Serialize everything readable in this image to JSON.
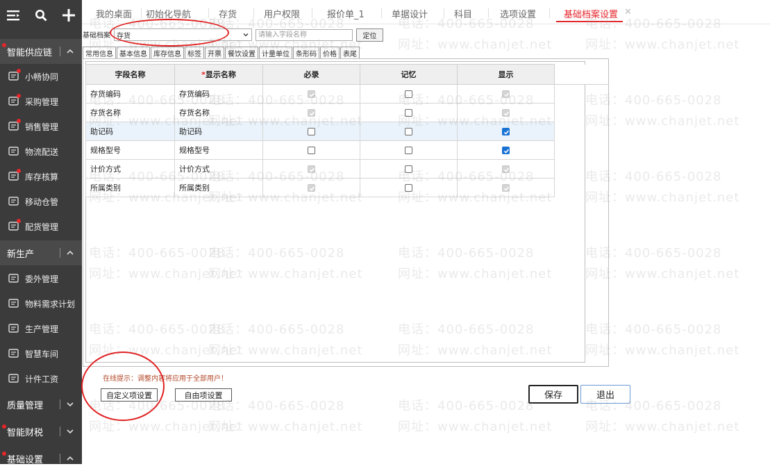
{
  "sidebar": {
    "sections": [
      {
        "label": "智能供应链"
      },
      {
        "label": "新生产"
      },
      {
        "label": "质量管理"
      },
      {
        "label": "智能财税"
      },
      {
        "label": "基础设置"
      }
    ],
    "items_a": [
      {
        "label": "小畅协同",
        "icon": "people-icon"
      },
      {
        "label": "采购管理",
        "icon": "cart-icon"
      },
      {
        "label": "销售管理",
        "icon": "bar-chart-icon"
      },
      {
        "label": "物流配送",
        "icon": "truck-icon"
      },
      {
        "label": "库存核算",
        "icon": "warehouse-icon"
      },
      {
        "label": "移动仓管",
        "icon": "mobile-warehouse-icon"
      },
      {
        "label": "配货管理",
        "icon": "distribution-icon"
      }
    ],
    "items_b": [
      {
        "label": "委外管理",
        "icon": "outsource-icon"
      },
      {
        "label": "物料需求计划",
        "icon": "material-plan-icon"
      },
      {
        "label": "生产管理",
        "icon": "production-icon"
      },
      {
        "label": "智慧车间",
        "icon": "workshop-icon"
      },
      {
        "label": "计件工资",
        "icon": "wage-icon"
      }
    ]
  },
  "tabs": [
    {
      "label": "我的桌面"
    },
    {
      "label": "初始化导航"
    },
    {
      "label": "存货"
    },
    {
      "label": "用户权限"
    },
    {
      "label": "报价单_1"
    },
    {
      "label": "单据设计"
    },
    {
      "label": "科目"
    },
    {
      "label": "选项设置"
    },
    {
      "label": "基础档案设置"
    }
  ],
  "toolbar": {
    "label": "基础档案",
    "select_value": "存货",
    "search_placeholder": "请输入字段名称",
    "locate_label": "定位"
  },
  "subtabs": [
    "常用信息",
    "基本信息",
    "库存信息",
    "标签",
    "开票",
    "餐饮设置",
    "计量单位",
    "条形码",
    "价格",
    "表尾"
  ],
  "grid": {
    "headers": {
      "field": "字段名称",
      "required_mark": "*",
      "display": "显示名称",
      "required": "必录",
      "memory": "记忆",
      "show": "显示"
    },
    "rows": [
      {
        "field": "存货编码",
        "display": "存货编码",
        "required": {
          "checked": true,
          "disabled": true
        },
        "memory": {
          "checked": false,
          "disabled": false
        },
        "show": {
          "checked": true,
          "disabled": true
        }
      },
      {
        "field": "存货名称",
        "display": "存货名称",
        "required": {
          "checked": true,
          "disabled": true
        },
        "memory": {
          "checked": false,
          "disabled": false
        },
        "show": {
          "checked": true,
          "disabled": true
        }
      },
      {
        "field": "助记码",
        "display": "助记码",
        "required": {
          "checked": false,
          "disabled": false
        },
        "memory": {
          "checked": false,
          "disabled": false
        },
        "show": {
          "checked": true,
          "disabled": false
        }
      },
      {
        "field": "规格型号",
        "display": "规格型号",
        "required": {
          "checked": false,
          "disabled": false
        },
        "memory": {
          "checked": false,
          "disabled": false
        },
        "show": {
          "checked": true,
          "disabled": false
        }
      },
      {
        "field": "计价方式",
        "display": "计价方式",
        "required": {
          "checked": true,
          "disabled": true
        },
        "memory": {
          "checked": false,
          "disabled": false
        },
        "show": {
          "checked": true,
          "disabled": true
        }
      },
      {
        "field": "所属类别",
        "display": "所属类别",
        "required": {
          "checked": true,
          "disabled": true
        },
        "memory": {
          "checked": false,
          "disabled": false
        },
        "show": {
          "checked": true,
          "disabled": true
        }
      }
    ]
  },
  "footer": {
    "tip": "在线提示：调整内容将应用于全部用户！",
    "custom_btn": "自定义项设置",
    "free_btn": "自由项设置",
    "save_btn": "保存",
    "exit_btn": "退出"
  },
  "watermark": {
    "phone": "电话：400-665-0028",
    "site": "网址：www.chanjet.net"
  },
  "colors": {
    "accent": "#e5262b",
    "sidebar": "#3b3b3b",
    "check": "#1a73d4"
  }
}
